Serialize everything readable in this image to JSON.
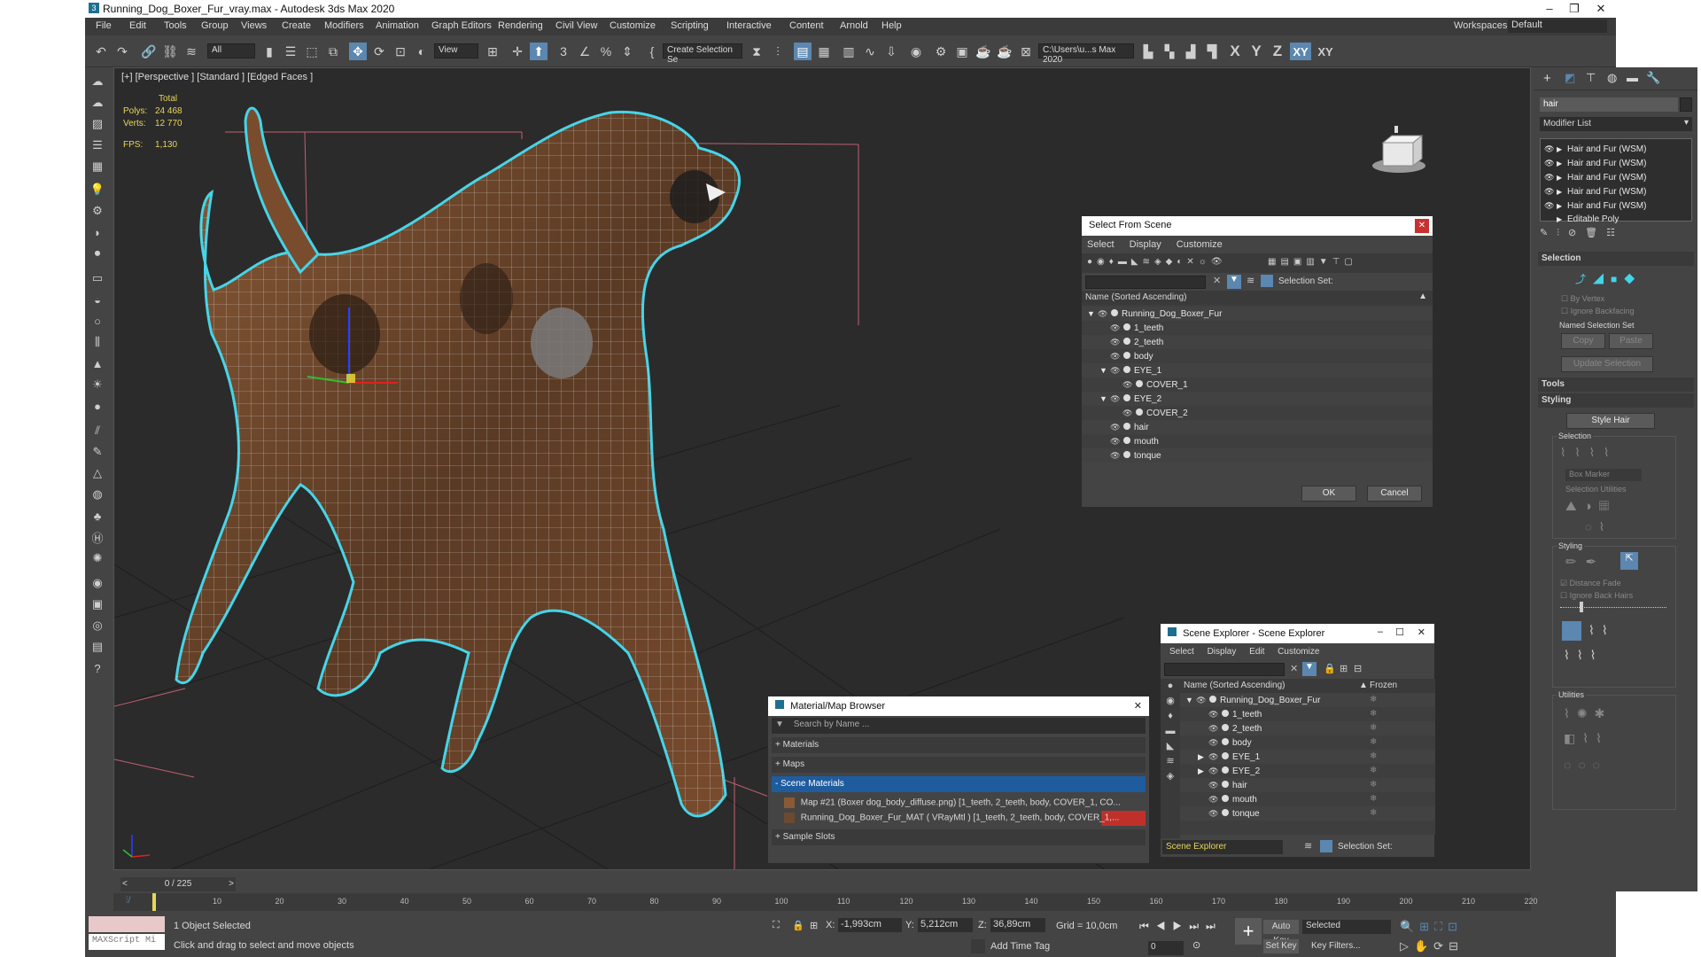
{
  "window": {
    "title": "Running_Dog_Boxer_Fur_vray.max - Autodesk 3ds Max 2020"
  },
  "menu": [
    "File",
    "Edit",
    "Tools",
    "Group",
    "Views",
    "Create",
    "Modifiers",
    "Animation",
    "Graph Editors",
    "Rendering",
    "Civil View",
    "Customize",
    "Scripting",
    "Interactive",
    "Content",
    "Arnold",
    "Help"
  ],
  "workspace": {
    "label": "Workspaces:",
    "value": "Default"
  },
  "toolbar": {
    "filter": "All",
    "view": "View",
    "selection_set": "Create Selection Se",
    "path": "C:\\Users\\u...s Max 2020",
    "axes": [
      "X",
      "Y",
      "Z",
      "XY",
      "XY"
    ]
  },
  "viewport": {
    "label": "[+] [Perspective ] [Standard ] [Edged Faces ]",
    "stats": {
      "total": "Total",
      "polys_label": "Polys:",
      "polys": "24 468",
      "verts_label": "Verts:",
      "verts": "12 770",
      "fps_label": "FPS:",
      "fps": "1,130"
    }
  },
  "select_from_scene": {
    "title": "Select From Scene",
    "menu": [
      "Select",
      "Display",
      "Customize"
    ],
    "selection_set_label": "Selection Set:",
    "column": "Name (Sorted Ascending)",
    "items": [
      {
        "name": "Running_Dog_Boxer_Fur",
        "level": 0
      },
      {
        "name": "1_teeth",
        "level": 1
      },
      {
        "name": "2_teeth",
        "level": 1
      },
      {
        "name": "body",
        "level": 1
      },
      {
        "name": "EYE_1",
        "level": 1
      },
      {
        "name": "COVER_1",
        "level": 2
      },
      {
        "name": "EYE_2",
        "level": 1
      },
      {
        "name": "COVER_2",
        "level": 2
      },
      {
        "name": "hair",
        "level": 1
      },
      {
        "name": "mouth",
        "level": 1
      },
      {
        "name": "tonque",
        "level": 1
      }
    ],
    "ok": "OK",
    "cancel": "Cancel"
  },
  "scene_explorer": {
    "title": "Scene Explorer - Scene Explorer",
    "menu": [
      "Select",
      "Display",
      "Edit",
      "Customize"
    ],
    "column": "Name (Sorted Ascending)",
    "frozen": "Frozen",
    "items": [
      "Running_Dog_Boxer_Fur",
      "1_teeth",
      "2_teeth",
      "body",
      "EYE_1",
      "EYE_2",
      "hair",
      "mouth",
      "tonque"
    ],
    "footer_name": "Scene Explorer",
    "selection_set_label": "Selection Set:"
  },
  "material_browser": {
    "title": "Material/Map Browser",
    "search_placeholder": "Search by Name ...",
    "groups": [
      "+ Materials",
      "+ Maps",
      "- Scene Materials"
    ],
    "entries": [
      "Map #21 (Boxer dog_body_diffuse.png) [1_teeth, 2_teeth, body, COVER_1, CO...",
      "Running_Dog_Boxer_Fur_MAT  ( VRayMtl ) [1_teeth, 2_teeth, body, COVER_1,..."
    ],
    "sample_slots": "+ Sample Slots"
  },
  "command_panel": {
    "search": "hair",
    "modifier_list": "Modifier List",
    "stack": [
      "Hair and Fur (WSM)",
      "Hair and Fur (WSM)",
      "Hair and Fur (WSM)",
      "Hair and Fur (WSM)",
      "Hair and Fur (WSM)",
      "Editable Poly"
    ],
    "rollouts": {
      "selection": "Selection",
      "by_vertex": "By Vertex",
      "ignore_backfacing": "Ignore Backfacing",
      "named_selection_set": "Named Selection Set",
      "copy": "Copy",
      "paste": "Paste",
      "update_selection": "Update Selection",
      "tools": "Tools",
      "styling": "Styling",
      "style_hair": "Style Hair",
      "selection_sub": "Selection",
      "box_marker": "Box Marker",
      "selection_utilities": "Selection Utilities",
      "styling_sub": "Styling",
      "distance_fade": "Distance Fade",
      "ignore_back_hairs": "Ignore Back Hairs",
      "utilities": "Utilities"
    }
  },
  "timeline": {
    "frame": "0 / 225",
    "ticks": [
      "10",
      "20",
      "30",
      "40",
      "50",
      "60",
      "70",
      "80",
      "90",
      "100",
      "110",
      "120",
      "130",
      "140",
      "150",
      "160",
      "170",
      "180",
      "190",
      "200",
      "210",
      "220"
    ]
  },
  "status": {
    "maxscript": "MAXScript Mi",
    "selected": "1 Object Selected",
    "prompt": "Click and drag to select and move objects",
    "x_label": "X:",
    "x": "-1,993cm",
    "y_label": "Y:",
    "y": "5,212cm",
    "z_label": "Z:",
    "z": "36,89cm",
    "grid": "Grid = 10,0cm",
    "add_time_tag": "Add Time Tag",
    "auto_key": "Auto Key",
    "auto_key_value": "Selected",
    "set_key": "Set Key",
    "key_filters": "Key Filters...",
    "frame_value": "0"
  },
  "colors": {
    "accent": "#5b87b0",
    "selection_outline": "#44d4e8",
    "stats_text": "#e8d55a",
    "material_red": "#c0302a"
  }
}
